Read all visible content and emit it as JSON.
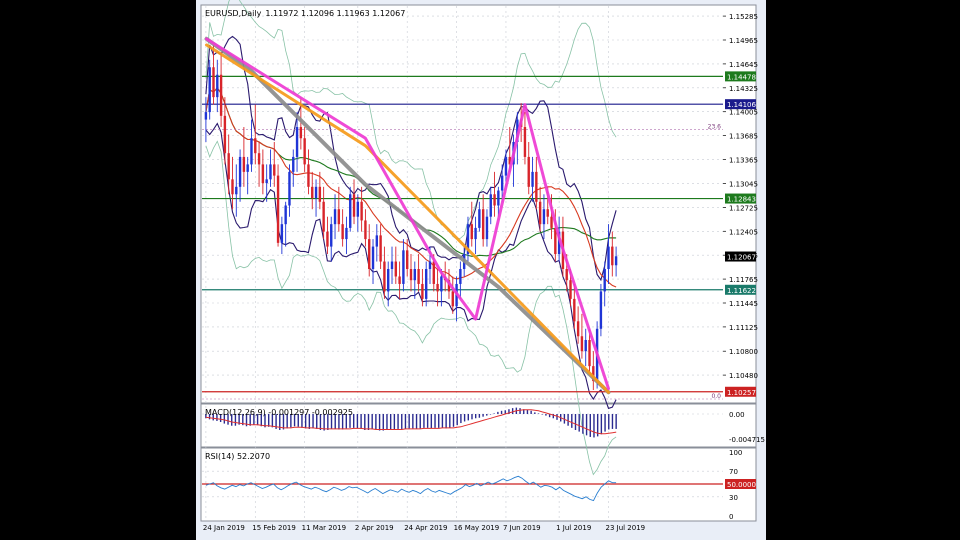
{
  "header": {
    "symbol": "EURUSD,Daily",
    "ohlc": "1.11972 1.12096 1.11963 1.12067"
  },
  "colors": {
    "background": "#ffffff",
    "grid": "#c8ccd4",
    "bull": "#1f35d6",
    "bear": "#d8242a",
    "bollinger_outer": "#88c2a6",
    "envelope": "#2a1a6e",
    "ma_green": "#1f7a1f",
    "ma_red": "#d83a20",
    "trend_gray": "#8c8c8c",
    "trend_orange": "#f59a1a",
    "trend_magenta": "#ee3bd2",
    "level_green": "#1d7a1d",
    "level_navy": "#1a1a8c",
    "level_teal": "#1a7a6a",
    "level_red": "#cc2222",
    "macd_hist": "#2a2a90",
    "macd_signal": "#e03030",
    "rsi_line": "#2a7fd0",
    "rsi_level": "#cc2222",
    "current_price_label": "#000000"
  },
  "chart_data": [
    {
      "type": "candlestick",
      "title": "EURUSD,Daily",
      "x_tick_labels": [
        "24 Jan 2019",
        "15 Feb 2019",
        "11 Mar 2019",
        "2 Apr 2019",
        "24 Apr 2019",
        "16 May 2019",
        "7 Jun 2019",
        "1 Jul 2019",
        "23 Jul 2019"
      ],
      "y_tick_labels": [
        "1.15285",
        "1.14965",
        "1.14645",
        "1.14325",
        "1.14005",
        "1.13685",
        "1.13365",
        "1.13045",
        "1.12725",
        "1.12405",
        "1.12085",
        "1.11765",
        "1.11445",
        "1.11125",
        "1.10800",
        "1.10480"
      ],
      "ylim": [
        1.1012,
        1.1542
      ],
      "price_levels": [
        {
          "value": 1.14478,
          "label": "1.14478",
          "color": "#1d7a1d"
        },
        {
          "value": 1.14106,
          "label": "1.14106",
          "color": "#1a1a8c"
        },
        {
          "value": 1.12843,
          "label": "1.12843",
          "color": "#1d7a1d"
        },
        {
          "value": 1.11622,
          "label": "1.11622",
          "color": "#1a7a6a"
        },
        {
          "value": 1.10257,
          "label": "1.10257",
          "color": "#cc2222"
        }
      ],
      "current_price": {
        "value": 1.12067,
        "label": "1.12067"
      },
      "fib_labels": [
        {
          "value": 1.1377,
          "text": "23.6"
        },
        {
          "value": 1.1016,
          "text": "0.0"
        }
      ],
      "trendlines": [
        {
          "name": "gray",
          "points": [
            [
              1.15,
              1.1498
            ],
            [
              13,
              1.1455
            ],
            [
              43,
              1.1303
            ],
            [
              78,
              1.1166
            ],
            [
              107,
              1.1025
            ]
          ]
        },
        {
          "name": "orange",
          "points": [
            [
              1.15,
              1.149
            ],
            [
              43,
              1.1355
            ],
            [
              78,
              1.1175
            ],
            [
              107,
              1.1025
            ]
          ]
        },
        {
          "name": "magenta",
          "points": [
            [
              1.15,
              1.1498
            ],
            [
              43,
              1.1365
            ],
            [
              63,
              1.1185
            ],
            [
              72,
              1.1123
            ],
            [
              85,
              1.141
            ],
            [
              94,
              1.1232
            ],
            [
              107,
              1.103
            ]
          ]
        }
      ],
      "candles": [
        [
          1.139,
          1.142,
          1.136,
          1.14
        ],
        [
          1.14,
          1.147,
          1.139,
          1.146
        ],
        [
          1.146,
          1.149,
          1.141,
          1.142
        ],
        [
          1.142,
          1.147,
          1.14,
          1.145
        ],
        [
          1.145,
          1.148,
          1.138,
          1.1395
        ],
        [
          1.1395,
          1.142,
          1.133,
          1.1345
        ],
        [
          1.1345,
          1.137,
          1.129,
          1.131
        ],
        [
          1.131,
          1.134,
          1.127,
          1.129
        ],
        [
          1.129,
          1.133,
          1.126,
          1.13
        ],
        [
          1.13,
          1.135,
          1.128,
          1.134
        ],
        [
          1.134,
          1.138,
          1.13,
          1.132
        ],
        [
          1.132,
          1.134,
          1.129,
          1.133
        ],
        [
          1.133,
          1.139,
          1.132,
          1.1365
        ],
        [
          1.1365,
          1.141,
          1.133,
          1.1345
        ],
        [
          1.1345,
          1.136,
          1.13,
          1.133
        ],
        [
          1.133,
          1.135,
          1.129,
          1.1305
        ],
        [
          1.1305,
          1.133,
          1.128,
          1.131
        ],
        [
          1.131,
          1.135,
          1.13,
          1.133
        ],
        [
          1.133,
          1.136,
          1.13,
          1.1315
        ],
        [
          1.1315,
          1.133,
          1.122,
          1.1225
        ],
        [
          1.1225,
          1.126,
          1.121,
          1.125
        ],
        [
          1.125,
          1.128,
          1.122,
          1.1275
        ],
        [
          1.1275,
          1.133,
          1.126,
          1.132
        ],
        [
          1.132,
          1.135,
          1.13,
          1.134
        ],
        [
          1.134,
          1.14,
          1.132,
          1.138
        ],
        [
          1.138,
          1.142,
          1.135,
          1.1365
        ],
        [
          1.1365,
          1.138,
          1.132,
          1.133
        ],
        [
          1.133,
          1.135,
          1.129,
          1.13
        ],
        [
          1.13,
          1.132,
          1.127,
          1.1285
        ],
        [
          1.1285,
          1.131,
          1.126,
          1.13
        ],
        [
          1.13,
          1.132,
          1.127,
          1.128
        ],
        [
          1.128,
          1.13,
          1.123,
          1.124
        ],
        [
          1.124,
          1.126,
          1.121,
          1.122
        ],
        [
          1.122,
          1.126,
          1.12,
          1.125
        ],
        [
          1.125,
          1.129,
          1.123,
          1.127
        ],
        [
          1.127,
          1.13,
          1.124,
          1.125
        ],
        [
          1.125,
          1.127,
          1.122,
          1.123
        ],
        [
          1.123,
          1.126,
          1.121,
          1.1245
        ],
        [
          1.1245,
          1.13,
          1.124,
          1.129
        ],
        [
          1.129,
          1.131,
          1.125,
          1.126
        ],
        [
          1.126,
          1.129,
          1.124,
          1.128
        ],
        [
          1.128,
          1.13,
          1.124,
          1.1255
        ],
        [
          1.1255,
          1.127,
          1.122,
          1.123
        ],
        [
          1.123,
          1.125,
          1.118,
          1.119
        ],
        [
          1.119,
          1.123,
          1.117,
          1.122
        ],
        [
          1.122,
          1.125,
          1.12,
          1.1235
        ],
        [
          1.1235,
          1.125,
          1.119,
          1.12
        ],
        [
          1.12,
          1.122,
          1.115,
          1.116
        ],
        [
          1.116,
          1.12,
          1.114,
          1.119
        ],
        [
          1.119,
          1.122,
          1.117,
          1.12
        ],
        [
          1.12,
          1.122,
          1.117,
          1.118
        ],
        [
          1.118,
          1.12,
          1.115,
          1.117
        ],
        [
          1.117,
          1.123,
          1.116,
          1.1215
        ],
        [
          1.1215,
          1.123,
          1.118,
          1.119
        ],
        [
          1.119,
          1.121,
          1.116,
          1.1175
        ],
        [
          1.1175,
          1.12,
          1.115,
          1.119
        ],
        [
          1.119,
          1.121,
          1.116,
          1.117
        ],
        [
          1.117,
          1.119,
          1.114,
          1.115
        ],
        [
          1.115,
          1.12,
          1.114,
          1.119
        ],
        [
          1.119,
          1.122,
          1.117,
          1.12
        ],
        [
          1.12,
          1.121,
          1.116,
          1.117
        ],
        [
          1.117,
          1.119,
          1.114,
          1.116
        ],
        [
          1.116,
          1.119,
          1.114,
          1.118
        ],
        [
          1.118,
          1.12,
          1.116,
          1.1175
        ],
        [
          1.1175,
          1.119,
          1.115,
          1.116
        ],
        [
          1.116,
          1.118,
          1.113,
          1.114
        ],
        [
          1.114,
          1.118,
          1.112,
          1.117
        ],
        [
          1.117,
          1.12,
          1.115,
          1.119
        ],
        [
          1.119,
          1.122,
          1.118,
          1.121
        ],
        [
          1.121,
          1.126,
          1.12,
          1.125
        ],
        [
          1.125,
          1.128,
          1.122,
          1.123
        ],
        [
          1.123,
          1.126,
          1.121,
          1.1245
        ],
        [
          1.1245,
          1.128,
          1.124,
          1.127
        ],
        [
          1.127,
          1.129,
          1.122,
          1.123
        ],
        [
          1.123,
          1.127,
          1.122,
          1.126
        ],
        [
          1.126,
          1.13,
          1.125,
          1.129
        ],
        [
          1.129,
          1.132,
          1.126,
          1.1275
        ],
        [
          1.1275,
          1.13,
          1.126,
          1.1295
        ],
        [
          1.1295,
          1.133,
          1.128,
          1.1315
        ],
        [
          1.1315,
          1.135,
          1.13,
          1.134
        ],
        [
          1.134,
          1.138,
          1.132,
          1.133
        ],
        [
          1.133,
          1.137,
          1.13,
          1.136
        ],
        [
          1.136,
          1.14,
          1.133,
          1.139
        ],
        [
          1.139,
          1.1412,
          1.136,
          1.138
        ],
        [
          1.138,
          1.14,
          1.133,
          1.134
        ],
        [
          1.134,
          1.136,
          1.129,
          1.13
        ],
        [
          1.13,
          1.134,
          1.128,
          1.132
        ],
        [
          1.132,
          1.134,
          1.127,
          1.128
        ],
        [
          1.128,
          1.13,
          1.124,
          1.125
        ],
        [
          1.125,
          1.129,
          1.123,
          1.127
        ],
        [
          1.127,
          1.13,
          1.125,
          1.126
        ],
        [
          1.126,
          1.129,
          1.123,
          1.1245
        ],
        [
          1.1245,
          1.127,
          1.12,
          1.121
        ],
        [
          1.121,
          1.126,
          1.12,
          1.124
        ],
        [
          1.124,
          1.126,
          1.118,
          1.119
        ],
        [
          1.119,
          1.121,
          1.116,
          1.1175
        ],
        [
          1.1175,
          1.119,
          1.114,
          1.115
        ],
        [
          1.115,
          1.117,
          1.111,
          1.112
        ],
        [
          1.112,
          1.114,
          1.109,
          1.11
        ],
        [
          1.11,
          1.113,
          1.107,
          1.108
        ],
        [
          1.108,
          1.111,
          1.106,
          1.1095
        ],
        [
          1.1095,
          1.111,
          1.105,
          1.106
        ],
        [
          1.106,
          1.108,
          1.1028,
          1.104
        ],
        [
          1.104,
          1.112,
          1.103,
          1.111
        ],
        [
          1.111,
          1.117,
          1.11,
          1.116
        ],
        [
          1.116,
          1.12,
          1.114,
          1.119
        ],
        [
          1.119,
          1.125,
          1.117,
          1.122
        ],
        [
          1.122,
          1.124,
          1.118,
          1.1195
        ],
        [
          1.1195,
          1.122,
          1.118,
          1.1207
        ]
      ]
    },
    {
      "type": "bar",
      "title": "MACD(12,26,9) -0.001297 -0.002925",
      "y_tick_labels": [
        "0.00",
        "-0.004715"
      ],
      "ylim": [
        -0.006,
        0.0015
      ],
      "values": [
        -0.0008,
        -0.001,
        -0.0012,
        -0.0013,
        -0.0015,
        -0.0018,
        -0.002,
        -0.0022,
        -0.0022,
        -0.002,
        -0.0021,
        -0.0023,
        -0.0022,
        -0.002,
        -0.0021,
        -0.0023,
        -0.0025,
        -0.0024,
        -0.0025,
        -0.0028,
        -0.003,
        -0.0029,
        -0.0027,
        -0.0025,
        -0.0023,
        -0.0024,
        -0.0026,
        -0.0027,
        -0.0028,
        -0.0027,
        -0.0028,
        -0.003,
        -0.0031,
        -0.003,
        -0.0028,
        -0.0028,
        -0.0029,
        -0.0029,
        -0.0027,
        -0.0026,
        -0.0026,
        -0.0027,
        -0.0028,
        -0.003,
        -0.003,
        -0.0029,
        -0.0029,
        -0.0031,
        -0.0031,
        -0.003,
        -0.003,
        -0.003,
        -0.0028,
        -0.0028,
        -0.0028,
        -0.0027,
        -0.0027,
        -0.0028,
        -0.0027,
        -0.0026,
        -0.0026,
        -0.0027,
        -0.0026,
        -0.0026,
        -0.0026,
        -0.0027,
        -0.0026,
        -0.0024,
        -0.0021,
        -0.0017,
        -0.0014,
        -0.0012,
        -0.001,
        -0.0008,
        -0.0007,
        -0.0005,
        -0.0003,
        -0.0001,
        0.0001,
        0.0004,
        0.0006,
        0.0007,
        0.0009,
        0.0011,
        0.0012,
        0.0011,
        0.0009,
        0.0008,
        0.0006,
        0.0003,
        0.0001,
        -0.0001,
        -0.0003,
        -0.0006,
        -0.0008,
        -0.0011,
        -0.0014,
        -0.0018,
        -0.0022,
        -0.0026,
        -0.003,
        -0.0033,
        -0.0037,
        -0.004,
        -0.0043,
        -0.0044,
        -0.0042,
        -0.0038,
        -0.0033,
        -0.0029,
        -0.0028,
        -0.0028
      ],
      "signal": [
        -0.0006,
        -0.0007,
        -0.0008,
        -0.0009,
        -0.001,
        -0.0011,
        -0.0013,
        -0.0015,
        -0.0016,
        -0.0017,
        -0.0018,
        -0.0019,
        -0.002,
        -0.002,
        -0.002,
        -0.0021,
        -0.0022,
        -0.0022,
        -0.0023,
        -0.0024,
        -0.0025,
        -0.0026,
        -0.0026,
        -0.0026,
        -0.0025,
        -0.0025,
        -0.0025,
        -0.0026,
        -0.0026,
        -0.0026,
        -0.0027,
        -0.0027,
        -0.0028,
        -0.0028,
        -0.0028,
        -0.0028,
        -0.0028,
        -0.0028,
        -0.0028,
        -0.0028,
        -0.0027,
        -0.0027,
        -0.0027,
        -0.0028,
        -0.0028,
        -0.0028,
        -0.0029,
        -0.0029,
        -0.0029,
        -0.0029,
        -0.0029,
        -0.0029,
        -0.0029,
        -0.0029,
        -0.0028,
        -0.0028,
        -0.0028,
        -0.0028,
        -0.0028,
        -0.0027,
        -0.0027,
        -0.0027,
        -0.0027,
        -0.0027,
        -0.0026,
        -0.0026,
        -0.0026,
        -0.0026,
        -0.0025,
        -0.0024,
        -0.0022,
        -0.002,
        -0.0018,
        -0.0016,
        -0.0014,
        -0.0012,
        -0.001,
        -0.0008,
        -0.0006,
        -0.0004,
        -0.0002,
        0.0,
        0.0002,
        0.0004,
        0.0006,
        0.0007,
        0.0008,
        0.0008,
        0.0008,
        0.0007,
        0.0006,
        0.0004,
        0.0002,
        0.0,
        -0.0002,
        -0.0004,
        -0.0007,
        -0.001,
        -0.0013,
        -0.0016,
        -0.0019,
        -0.0022,
        -0.0025,
        -0.0028,
        -0.0031,
        -0.0034,
        -0.0036,
        -0.0037,
        -0.0037,
        -0.0036,
        -0.0035,
        -0.0034
      ]
    },
    {
      "type": "line",
      "title": "RSI(14) 52.2070",
      "y_tick_labels": [
        "100",
        "70",
        "50",
        "30",
        "0"
      ],
      "ylim": [
        0,
        100
      ],
      "level": {
        "value": 50,
        "label": "50.0000"
      },
      "values": [
        48,
        50,
        52,
        47,
        44,
        42,
        45,
        48,
        46,
        49,
        47,
        50,
        52,
        49,
        46,
        43,
        45,
        48,
        50,
        44,
        41,
        44,
        48,
        51,
        53,
        49,
        46,
        44,
        42,
        45,
        43,
        40,
        38,
        41,
        45,
        43,
        40,
        42,
        46,
        44,
        45,
        42,
        39,
        36,
        40,
        43,
        39,
        35,
        38,
        41,
        39,
        37,
        42,
        39,
        37,
        40,
        38,
        35,
        40,
        43,
        39,
        37,
        40,
        38,
        36,
        34,
        38,
        41,
        44,
        49,
        46,
        48,
        51,
        47,
        50,
        53,
        50,
        52,
        55,
        58,
        55,
        57,
        60,
        62,
        59,
        54,
        50,
        53,
        49,
        45,
        48,
        47,
        45,
        41,
        45,
        40,
        37,
        34,
        31,
        29,
        27,
        30,
        26,
        24,
        36,
        45,
        50,
        55,
        52,
        52
      ]
    }
  ]
}
